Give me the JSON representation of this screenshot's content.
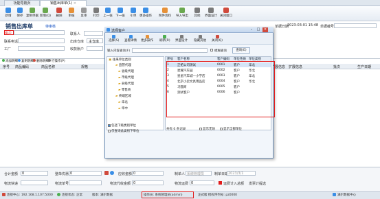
{
  "tabs": [
    {
      "label": "功能导航页"
    },
    {
      "label": "销售出库单(1)"
    }
  ],
  "toolbar": {
    "items": [
      {
        "label": "新增",
        "color": "#3a8ee6"
      },
      {
        "label": "保存",
        "color": "#3a8ee6"
      },
      {
        "label": "复制单据",
        "color": "#6aa84f"
      },
      {
        "label": "新增(Q)",
        "color": "#6aa84f"
      },
      {
        "label": "删除",
        "color": "#d04a3c"
      },
      {
        "label": "审核",
        "color": "#e69138"
      },
      {
        "label": "反审",
        "color": "#999999"
      },
      {
        "label": "打印",
        "color": "#7a7a7a"
      },
      {
        "label": "上一张",
        "color": "#3a8ee6"
      },
      {
        "label": "下一张",
        "color": "#3a8ee6"
      },
      {
        "label": "引单",
        "color": "#3a8ee6"
      },
      {
        "label": "更多操作",
        "color": "#3a8ee6"
      },
      {
        "label": "附件资料",
        "color": "#e69138"
      },
      {
        "label": "导入导出",
        "color": "#6aa84f"
      },
      {
        "label": "其他",
        "color": "#7a7a7a"
      },
      {
        "label": "界面设计",
        "color": "#7a7a7a"
      },
      {
        "label": "关闭窗口",
        "color": "#d04a3c"
      }
    ]
  },
  "form": {
    "title": "销售出库单",
    "title_link": "待审核",
    "date_label": "单据日期",
    "date_value": "2023-03-01 15:48",
    "no_label": "单据编号",
    "no_value": "",
    "customer_label": "客户",
    "customer_value": "",
    "contact_label": "联系人",
    "contact_value": "",
    "phone_label": "联系电话",
    "address_label": "收货地址",
    "warehouse_label": "出库仓库",
    "warehouse_value": "主仓库",
    "salesperson_label": "业务员",
    "payment_label": "收款账户",
    "account_label": "工厂",
    "remarks_label": "备注"
  },
  "grid": {
    "buttons": [
      "添加明细",
      "复制明细",
      "删除明细",
      "行操作(P)"
    ],
    "headers": [
      "序号",
      "商品编码",
      "商品名称",
      "规格",
      "单位",
      "数量",
      "单价",
      "金额",
      "备注",
      "扩展信息",
      "扩展信息",
      "批次",
      "生产日期"
    ]
  },
  "footer": {
    "total_qty_label": "合计金额",
    "total_qty_value": "0",
    "discount_label": "整单优惠",
    "discount_value": "0",
    "receivable_label": "应收金额",
    "receivable_value": "0",
    "maker_label": "制单人",
    "maker_value": "系统管理员",
    "make_date_label": "制单日期",
    "make_date_value": "2023/3/1",
    "logistics_label": "物流快递",
    "logistics_no_label": "物流单号",
    "freight_label": "物流代收金额",
    "freight_value": "0",
    "freight_fee_label": "物流运费",
    "freight_fee_value": "0",
    "fee_checkbox_label": "运费计入总额",
    "invoice_label": "发票计提选"
  },
  "status": {
    "server": "连接中心: 192.168.1.107:5000",
    "conn": "连接状态: 正常",
    "version": "版本: 满尔数据",
    "operator": "操作员: 系统管理员(admin)",
    "edition": "正式版 授权序列号: pz0000",
    "brand": "满尔数据中心"
  },
  "dialog": {
    "title": "选择客户",
    "toolbar": [
      "选择(S)",
      "查看详情",
      "更多操作",
      "刷新(R)",
      "界面设计",
      "隐藏其他",
      "关闭(Q)"
    ],
    "search_label": "输入内容查询(F)",
    "search_value": "",
    "fuzzy_label": "模糊查询",
    "search_button": "查询(E)",
    "tree_root": "往来单位类别",
    "tree_items": [
      "直营代理",
      "省级代理",
      "市级代理",
      "县级代理",
      "零售商",
      "终端区域",
      "华北",
      "华中"
    ],
    "tree_footer_checkbox": "包括下级类别单位",
    "tree_footer_checkbox2": "仅查询此类别下单位",
    "list_headers": [
      "序号",
      "客户名称",
      "客户编码",
      "单位性质",
      "单位类别"
    ],
    "rows": [
      {
        "no": "1",
        "name": "正拓公司测试",
        "code": "0001",
        "nature": "客户",
        "cat": "华北"
      },
      {
        "no": "2",
        "name": "星耀汽车园",
        "code": "0002",
        "nature": "客户",
        "cat": "华北"
      },
      {
        "no": "3",
        "name": "星星汽车城一小学店",
        "code": "0003",
        "nature": "客户",
        "cat": "华北"
      },
      {
        "no": "4",
        "name": "北京小卖文具用品店",
        "code": "0004",
        "nature": "客户",
        "cat": "华北"
      },
      {
        "no": "5",
        "name": "习圆商",
        "code": "0005",
        "nature": "客户",
        "cat": ""
      },
      {
        "no": "6",
        "name": "测试客户",
        "code": "0006",
        "nature": "客户",
        "cat": ""
      }
    ],
    "footer_count": "共有 6 条记录",
    "footer_check1": "显示无效",
    "footer_check2": "显示全部单位"
  }
}
